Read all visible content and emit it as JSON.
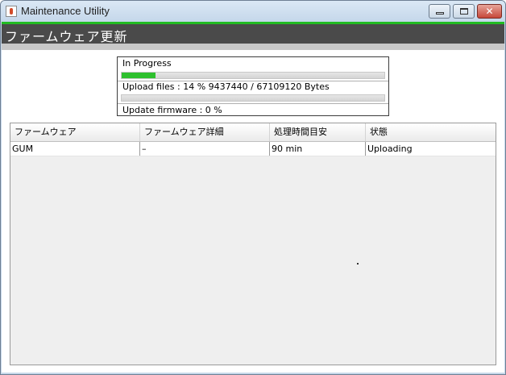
{
  "window": {
    "title": "Maintenance Utility",
    "close_glyph": "✕"
  },
  "header": {
    "title": "ファームウェア更新"
  },
  "progress": {
    "status": "In Progress",
    "upload_label": "Upload files : 14 % 9437440 / 67109120 Bytes",
    "upload_percent": 14,
    "update_label": "Update firmware : 0 %",
    "update_percent": 0,
    "status_bar_fraction": 0.13
  },
  "table": {
    "columns": [
      "ファームウェア",
      "ファームウェア詳細",
      "処理時間目安",
      "状態"
    ],
    "rows": [
      [
        "GUM",
        "–",
        "90 min",
        "Uploading"
      ]
    ]
  },
  "colors": {
    "accent": "#22bb22",
    "header_bg": "#4a4a4a",
    "progress_fill": "#2ec02e"
  }
}
